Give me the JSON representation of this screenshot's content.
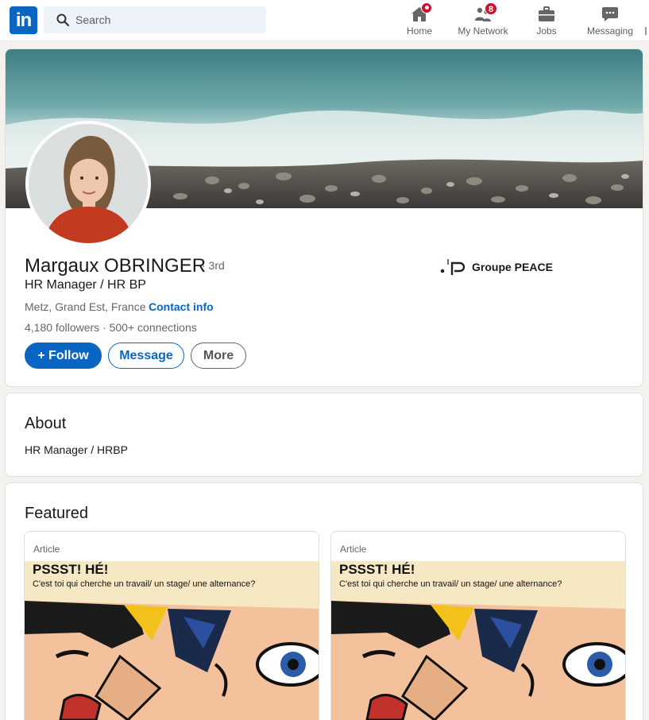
{
  "nav": {
    "logo": "in",
    "search_placeholder": "Search",
    "items": [
      {
        "label": "Home",
        "badge": ""
      },
      {
        "label": "My Network",
        "badge": "8"
      },
      {
        "label": "Jobs",
        "badge": ""
      },
      {
        "label": "Messaging",
        "badge": ""
      }
    ]
  },
  "profile": {
    "name": "Margaux OBRINGER",
    "degree": "· 3rd",
    "headline": "HR Manager / HR BP",
    "location": "Metz, Grand Est, France ·",
    "contact_info": "Contact info",
    "followers": "4,180 followers",
    "connections": "· 500+ connections",
    "company": "Groupe PEACE",
    "follow_label": "+ Follow",
    "message_label": "Message",
    "more_label": "More"
  },
  "about": {
    "title": "About",
    "text": "HR Manager / HRBP"
  },
  "featured": {
    "title": "Featured",
    "items": [
      {
        "type": "Article",
        "headline": "PSSST! HÉ!",
        "subtext": "C'est toi qui  cherche un travail/ un stage/ une alternance?"
      },
      {
        "type": "Article",
        "headline": "PSSST! HÉ!",
        "subtext": "C'est toi qui  cherche un travail/ un stage/ une alternance?"
      }
    ]
  },
  "colors": {
    "brand": "#0a66c2",
    "badge": "#cb112d",
    "page_bg": "#f4f2ee"
  }
}
